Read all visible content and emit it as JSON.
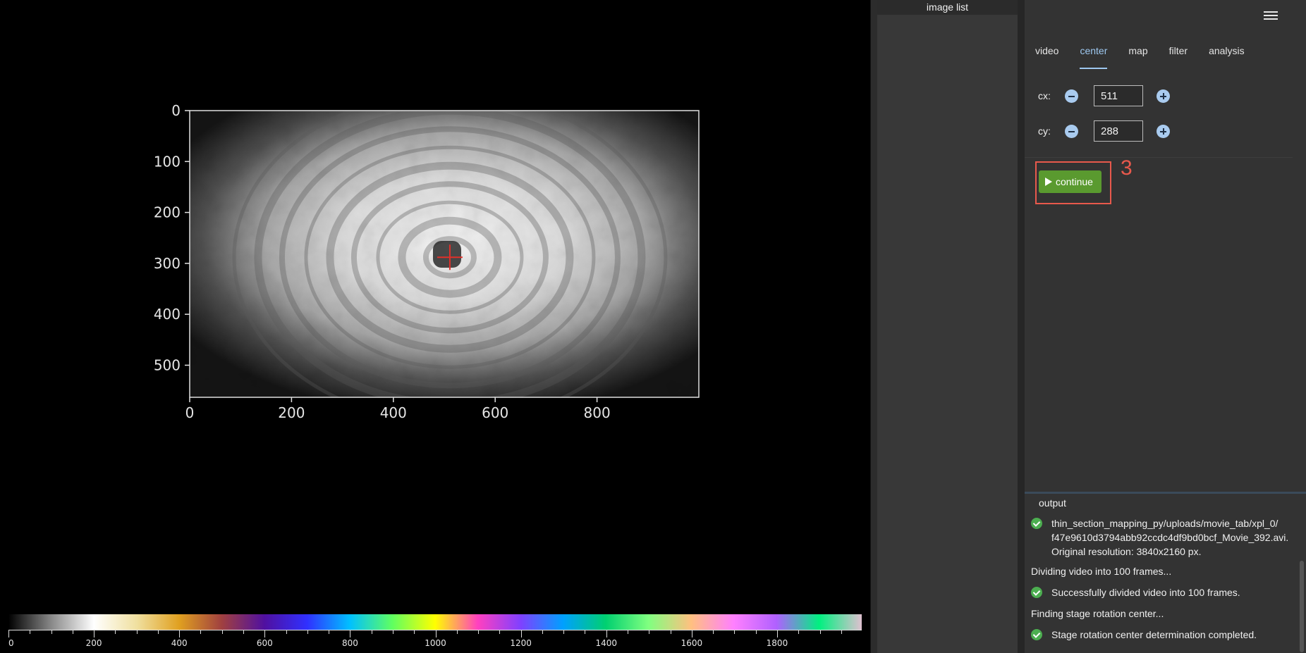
{
  "viewer": {
    "y_ticks": [
      "0",
      "100",
      "200",
      "300",
      "400",
      "500"
    ],
    "x_ticks": [
      "0",
      "200",
      "400",
      "600",
      "800"
    ],
    "image_shape": [
      1000,
      563
    ],
    "crosshair": {
      "x": 511,
      "y": 288,
      "color": "#e0302a"
    },
    "colorbar": {
      "range": [
        0,
        2000
      ],
      "tick_labels": [
        "0",
        "200",
        "400",
        "600",
        "800",
        "1000",
        "1200",
        "1400",
        "1600",
        "1800"
      ],
      "gradient_colors": [
        "#000000",
        "#888888",
        "#ffffff",
        "#f0e0a0",
        "#e0a020",
        "#a04040",
        "#5010a0",
        "#3030ff",
        "#00c0ff",
        "#60ff60",
        "#ffff00",
        "#ff40c0",
        "#8040ff",
        "#00a0ff",
        "#00d070",
        "#80ff80",
        "#ffc080",
        "#ff80ff",
        "#b060ff",
        "#00f080",
        "#e0c0d0"
      ]
    }
  },
  "image_list": {
    "title": "image list"
  },
  "menu_icon": "hamburger-menu-icon",
  "tabs": [
    {
      "label": "video",
      "active": false
    },
    {
      "label": "center",
      "active": true
    },
    {
      "label": "map",
      "active": false
    },
    {
      "label": "filter",
      "active": false
    },
    {
      "label": "analysis",
      "active": false
    }
  ],
  "center": {
    "cx": {
      "label": "cx:",
      "value": "511"
    },
    "cy": {
      "label": "cy:",
      "value": "288"
    },
    "continue_label": "continue",
    "annotation_number": "3",
    "annotation_color": "#e8594c",
    "button_color": "#5a9a2f"
  },
  "output": {
    "title": "output",
    "lines": [
      {
        "text": "thin_section_mapping_py/uploads/movie_tab/xpl_0/",
        "status": "ok"
      },
      {
        "text": "f47e9610d3794abb92ccdc4df9bd0bcf_Movie_392.avi.",
        "status": "none"
      },
      {
        "text": "Original resolution: 3840x2160 px.",
        "status": "none"
      },
      {
        "text": "Dividing video into 100 frames...",
        "status": "plain"
      },
      {
        "text": "Successfully divided video into 100 frames.",
        "status": "ok"
      },
      {
        "text": "Finding stage rotation center...",
        "status": "plain"
      },
      {
        "text": "Stage rotation center determination completed.",
        "status": "ok"
      }
    ]
  }
}
